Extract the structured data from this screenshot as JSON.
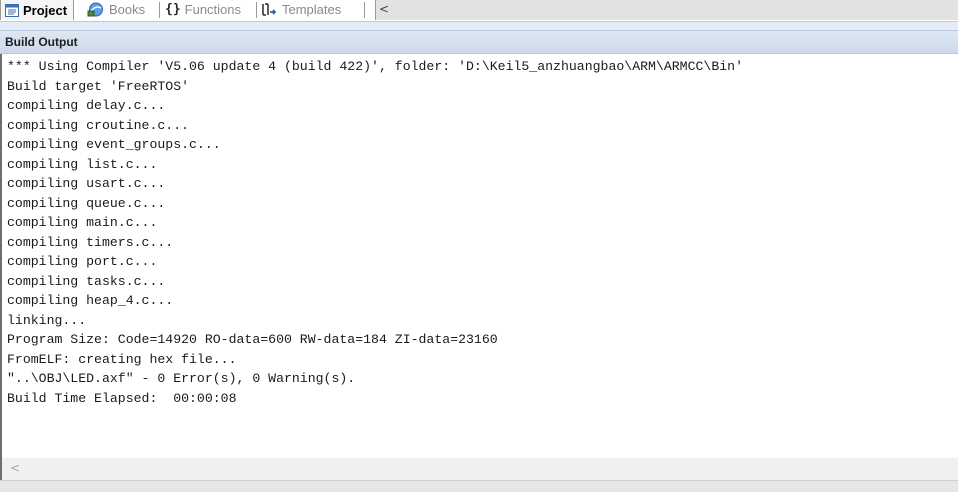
{
  "tabs": [
    {
      "label": "Project",
      "icon": "project-icon",
      "active": true
    },
    {
      "label": "Books",
      "icon": "books-icon",
      "active": false
    },
    {
      "label": "Functions",
      "icon": "functions-icon",
      "active": false
    },
    {
      "label": "Templates",
      "icon": "templates-icon",
      "active": false
    }
  ],
  "tab_scroll_arrow": "<",
  "panel": {
    "title": "Build Output"
  },
  "output": {
    "lines": [
      "*** Using Compiler 'V5.06 update 4 (build 422)', folder: 'D:\\Keil5_anzhuangbao\\ARM\\ARMCC\\Bin'",
      "Build target 'FreeRTOS'",
      "compiling delay.c...",
      "compiling croutine.c...",
      "compiling event_groups.c...",
      "compiling list.c...",
      "compiling usart.c...",
      "compiling queue.c...",
      "compiling main.c...",
      "compiling timers.c...",
      "compiling port.c...",
      "compiling tasks.c...",
      "compiling heap_4.c...",
      "linking...",
      "Program Size: Code=14920 RO-data=600 RW-data=184 ZI-data=23160",
      "FromELF: creating hex file...",
      "\"..\\OBJ\\LED.axf\" - 0 Error(s), 0 Warning(s).",
      "Build Time Elapsed:  00:00:08"
    ]
  },
  "hscroll_arrow": "<",
  "colors": {
    "accent": "#e4ecf7",
    "header": "#d3deed",
    "text": "#1a1a1a"
  }
}
